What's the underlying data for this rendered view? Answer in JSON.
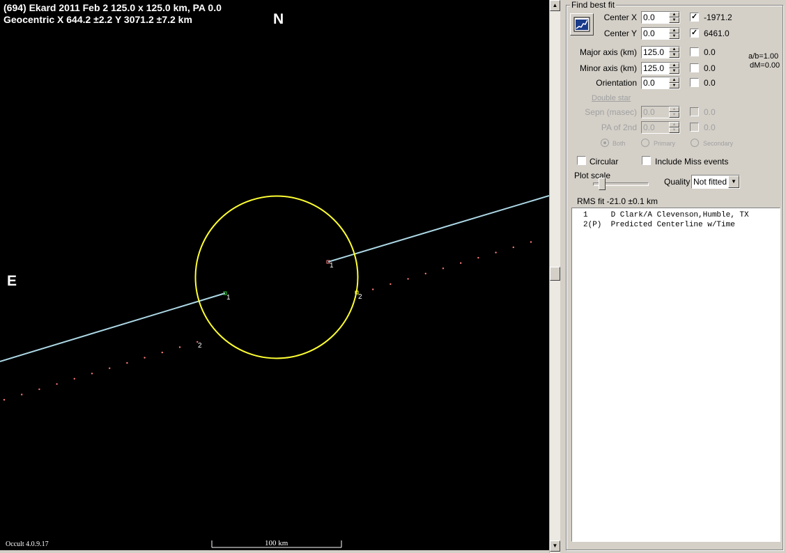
{
  "plot": {
    "title_line1": "(694) Ekard  2011 Feb 2  125.0 x 125.0 km,  PA 0.0",
    "title_line2": "Geocentric  X  644.2 ±2.2  Y 3071.2 ±7.2 km",
    "north_label": "N",
    "east_label": "E",
    "version": "Occult 4.0.9.17",
    "scale_bar_label": "100 km",
    "chord_labels": [
      "1",
      "1",
      "2",
      "2"
    ],
    "colors": {
      "background": "#000000",
      "ellipse": "#ffff33",
      "chord": "#add8e6",
      "predicted_dots": "#ff7b7b"
    }
  },
  "panel": {
    "group_title": "Find best fit",
    "fit_button_icon": "chart-fit-icon",
    "center_x": {
      "label": "Center X",
      "value": "0.0",
      "checked": true,
      "result": "-1971.2"
    },
    "center_y": {
      "label": "Center Y",
      "value": "0.0",
      "checked": true,
      "result": "6461.0"
    },
    "major_axis": {
      "label": "Major axis (km)",
      "value": "125.0",
      "checked": false,
      "result": "0.0"
    },
    "minor_axis": {
      "label": "Minor axis (km)",
      "value": "125.0",
      "checked": false,
      "result": "0.0"
    },
    "orientation": {
      "label": "Orientation",
      "value": "0.0",
      "checked": false,
      "result": "0.0"
    },
    "ab_ratio": "a/b=1.00",
    "dm": "dM=0.00",
    "double_star_label": "Double star",
    "sepn": {
      "label": "Sepn (masec)",
      "value": "0.0",
      "result": "0.0"
    },
    "pa2": {
      "label": "PA of 2nd",
      "value": "0.0",
      "result": "0.0"
    },
    "radio_both": "Both",
    "radio_primary": "Primary",
    "radio_secondary": "Secondary",
    "circular_label": "Circular",
    "include_miss_label": "Include Miss events",
    "plot_scale_label": "Plot scale",
    "plot_scale_value": 0.15,
    "quality_label": "Quality",
    "quality_value": "Not fitted",
    "rms_fit": "RMS fit  -21.0 ±0.1 km",
    "observations": [
      "1     D Clark/A Clevenson,Humble, TX",
      "2(P)  Predicted Centerline w/Time"
    ]
  }
}
